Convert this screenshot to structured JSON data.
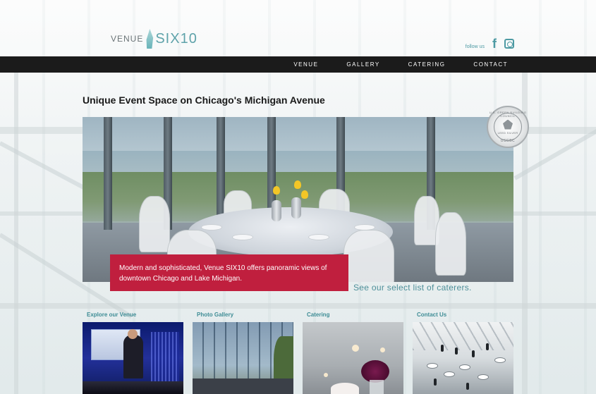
{
  "brand": {
    "logo_word1": "VENUE",
    "logo_word2": "SIX10"
  },
  "social": {
    "label": "follow us",
    "icons": [
      "facebook-icon",
      "instagram-icon"
    ]
  },
  "nav": {
    "items": [
      "VENUE",
      "GALLERY",
      "CATERING",
      "CONTACT"
    ]
  },
  "tagline": "Unique Event Space on Chicago's Michigan Avenue",
  "hero": {
    "caption": "Modern and sophisticated, Venue SIX10 offers panoramic views of downtown Chicago and Lake Michigan.",
    "caterers_link": "See our select list of caterers."
  },
  "badge": {
    "top_text": "U.S. GREEN BUILDING COUNCIL",
    "level": "LEED SILVER",
    "bottom_text": "USGBC"
  },
  "tiles": [
    {
      "title": "Explore our Venue"
    },
    {
      "title": "Photo Gallery"
    },
    {
      "title": "Catering"
    },
    {
      "title": "Contact Us"
    }
  ],
  "colors": {
    "nav_bg": "#1b1b1b",
    "accent_teal": "#4d9aa3",
    "caption_red": "#c01f3e"
  }
}
